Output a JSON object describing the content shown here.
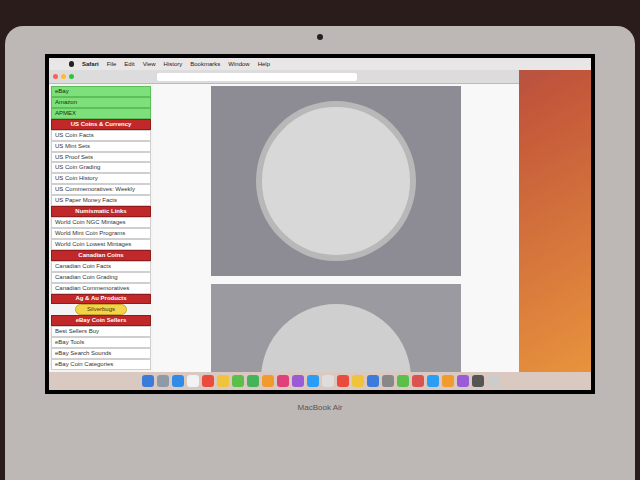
{
  "menubar": {
    "items": [
      "Safari",
      "File",
      "Edit",
      "View",
      "History",
      "Bookmarks",
      "Window",
      "Help"
    ]
  },
  "sidebar": {
    "items": [
      {
        "label": "eBay",
        "kind": "highlight"
      },
      {
        "label": "Amazon",
        "kind": "highlight"
      },
      {
        "label": "APMEX",
        "kind": "highlight"
      },
      {
        "label": "US Coins & Currency",
        "kind": "header"
      },
      {
        "label": "US Coin Facts",
        "kind": "link"
      },
      {
        "label": "US Mint Sets",
        "kind": "link"
      },
      {
        "label": "US Proof Sets",
        "kind": "link"
      },
      {
        "label": "US Coin Grading",
        "kind": "link"
      },
      {
        "label": "US Coin History",
        "kind": "link"
      },
      {
        "label": "US Commemoratives: Weekly",
        "kind": "link"
      },
      {
        "label": "US Paper Money Facts",
        "kind": "link"
      },
      {
        "label": "Numismatic Links",
        "kind": "header"
      },
      {
        "label": "World Coin NGC Mintages",
        "kind": "link"
      },
      {
        "label": "World Mint Coin Programs",
        "kind": "link"
      },
      {
        "label": "World Coin Lowest Mintages",
        "kind": "link"
      },
      {
        "label": "Canadian Coins",
        "kind": "header"
      },
      {
        "label": "Canadian Coin Facts",
        "kind": "link"
      },
      {
        "label": "Canadian Coin Grading",
        "kind": "link"
      },
      {
        "label": "Canadian Commemoratives",
        "kind": "link"
      },
      {
        "label": "Ag & Au Products",
        "kind": "header"
      },
      {
        "label": "Silverbugs",
        "kind": "badge"
      },
      {
        "label": "eBay Coin Sellers",
        "kind": "header"
      },
      {
        "label": "Best Sellers Buy",
        "kind": "link"
      },
      {
        "label": "eBay Tools",
        "kind": "link"
      },
      {
        "label": "eBay Search Sounds",
        "kind": "link"
      },
      {
        "label": "eBay Coin Categories",
        "kind": "link"
      }
    ]
  },
  "dock": [
    {
      "color": "#3b7bd9"
    },
    {
      "color": "#8e9aa8"
    },
    {
      "color": "#2f8be6"
    },
    {
      "color": "#f2f2f2"
    },
    {
      "color": "#e94b3c"
    },
    {
      "color": "#f0c33c"
    },
    {
      "color": "#5bbf4a"
    },
    {
      "color": "#44b35a"
    },
    {
      "color": "#f19a2e"
    },
    {
      "color": "#e0417a"
    },
    {
      "color": "#9a5bd6"
    },
    {
      "color": "#2a9df4"
    },
    {
      "color": "#dddddd"
    },
    {
      "color": "#e94b3c"
    },
    {
      "color": "#f0c33c"
    },
    {
      "color": "#3b7bd9"
    },
    {
      "color": "#888888"
    },
    {
      "color": "#5bbf4a"
    },
    {
      "color": "#d9534f"
    },
    {
      "color": "#2a9df4"
    },
    {
      "color": "#f19a2e"
    },
    {
      "color": "#9a5bd6"
    },
    {
      "color": "#555555"
    },
    {
      "color": "#cccccc"
    }
  ],
  "bezel": {
    "label": "MacBook Air"
  }
}
